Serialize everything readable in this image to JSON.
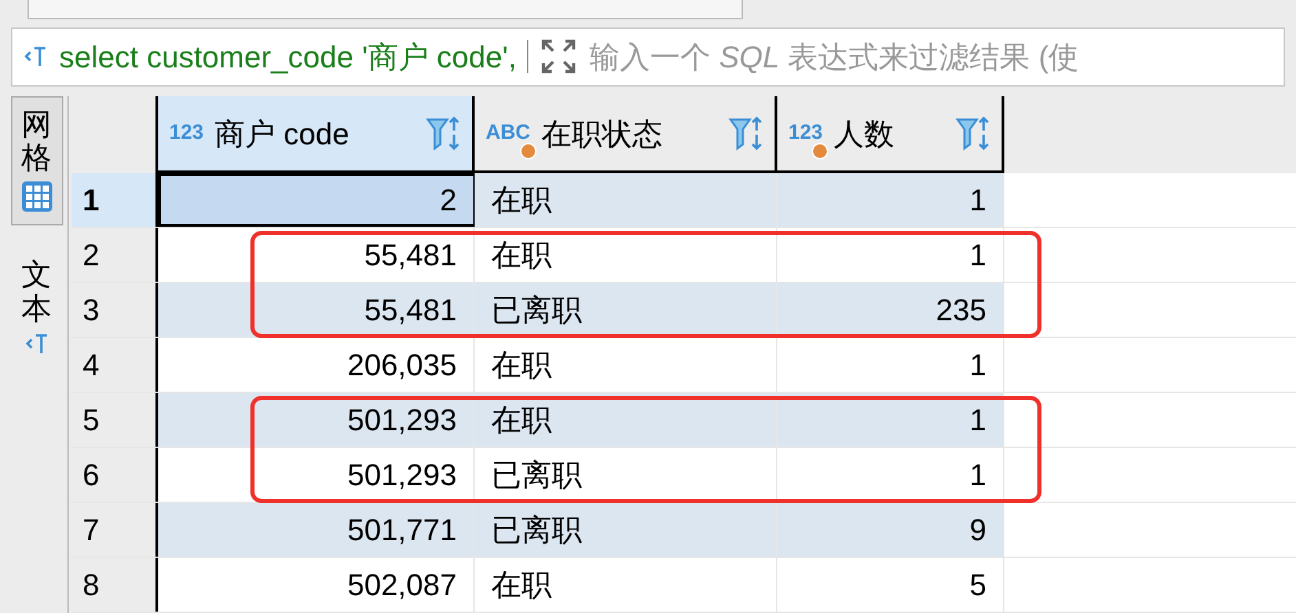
{
  "filter_bar": {
    "query": "select customer_code '商户 code',",
    "placeholder": "输入一个 *SQL* 表达式来过滤结果 (使"
  },
  "side_tabs": [
    {
      "label": "网格",
      "selected": true,
      "kind": "grid"
    },
    {
      "label": "文本",
      "selected": false,
      "kind": "text"
    }
  ],
  "table": {
    "columns": [
      {
        "type_label": "123",
        "title": "商户 code",
        "kind": "numeric",
        "selected": true,
        "marker": false
      },
      {
        "type_label": "ABC",
        "title": "在职状态",
        "kind": "textual",
        "selected": false,
        "marker": true
      },
      {
        "type_label": "123",
        "title": "人数",
        "kind": "numeric",
        "selected": false,
        "marker": true
      }
    ],
    "rows": [
      {
        "num": "1",
        "cells": [
          "2",
          "在职",
          "1"
        ],
        "selected": true,
        "boxed": false
      },
      {
        "num": "2",
        "cells": [
          "55,481",
          "在职",
          "1"
        ],
        "selected": false,
        "boxed": true
      },
      {
        "num": "3",
        "cells": [
          "55,481",
          "已离职",
          "235"
        ],
        "selected": false,
        "boxed": true
      },
      {
        "num": "4",
        "cells": [
          "206,035",
          "在职",
          "1"
        ],
        "selected": false,
        "boxed": false
      },
      {
        "num": "5",
        "cells": [
          "501,293",
          "在职",
          "1"
        ],
        "selected": false,
        "boxed": true
      },
      {
        "num": "6",
        "cells": [
          "501,293",
          "已离职",
          "1"
        ],
        "selected": false,
        "boxed": true
      },
      {
        "num": "7",
        "cells": [
          "501,771",
          "已离职",
          "9"
        ],
        "selected": false,
        "boxed": false
      },
      {
        "num": "8",
        "cells": [
          "502,087",
          "在职",
          "5"
        ],
        "selected": false,
        "boxed": false
      }
    ]
  }
}
